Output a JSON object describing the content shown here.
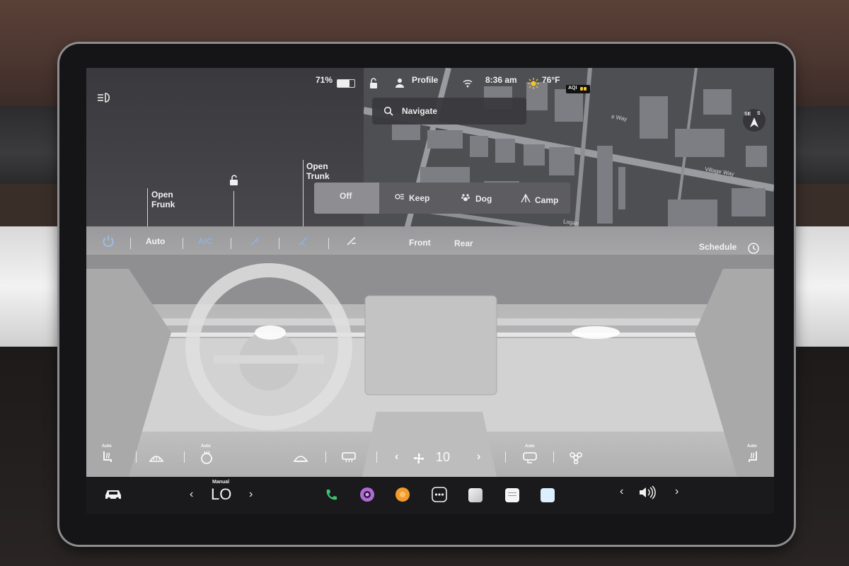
{
  "status": {
    "battery_percent": "71%",
    "battery_level": 0.71,
    "profile_label": "Profile",
    "time": "8:36 am",
    "temperature": "76°F",
    "aqi_label": "AQI"
  },
  "navigation": {
    "search_placeholder": "Navigate",
    "compass": {
      "left": "SE",
      "right": "S"
    },
    "streets": [
      "Village Way",
      "Logan",
      "e Way"
    ]
  },
  "car": {
    "open_frunk": "Open\nFrunk",
    "open_trunk": "Open\nTrunk"
  },
  "climate_keeper": {
    "options": [
      "Off",
      "Keep",
      "Dog",
      "Camp"
    ],
    "selected": "Off"
  },
  "climate": {
    "auto_label": "Auto",
    "ac_label": "A/C",
    "front_label": "Front",
    "rear_label": "Rear",
    "schedule_label": "Schedule",
    "fan_speed": "10",
    "auto_tag": "Auto"
  },
  "taskbar": {
    "temp_mode": "Manual",
    "temp_value": "LO"
  },
  "colors": {
    "accent_blue": "#8fb2da",
    "phone_green": "#3ec46d",
    "camera_purple": "#b06ad6",
    "music_orange": "#f29a2e",
    "sun_yellow": "#f4c430"
  }
}
